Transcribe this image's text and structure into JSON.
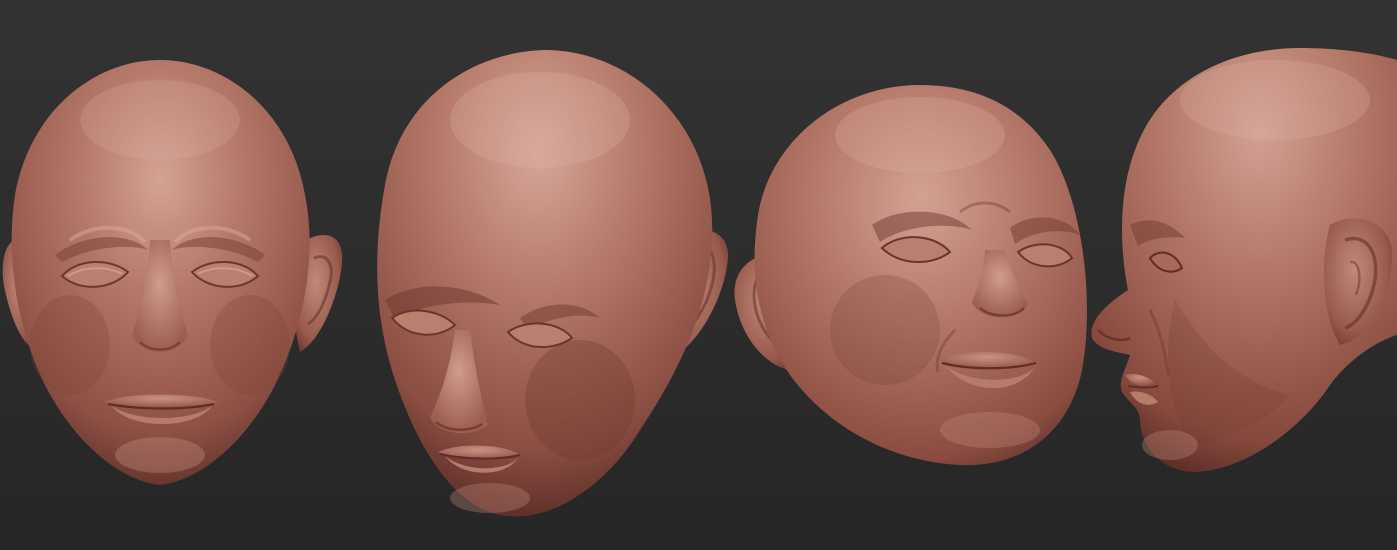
{
  "viewport": {
    "background": "#2b2b2b",
    "background_gradient": [
      "#323232",
      "#262626"
    ]
  },
  "material": {
    "base": "#a86a5c",
    "light": "#c99585",
    "highlight": "#d8aa9b",
    "shadow": "#6e3c32",
    "deep_shadow": "#4b2620"
  },
  "heads": [
    {
      "view": "front",
      "name": "front-view"
    },
    {
      "view": "three-quarter-down-left",
      "name": "three-quarter-left-view"
    },
    {
      "view": "three-quarter-up-right",
      "name": "three-quarter-right-view"
    },
    {
      "view": "profile-left",
      "name": "profile-view"
    }
  ]
}
